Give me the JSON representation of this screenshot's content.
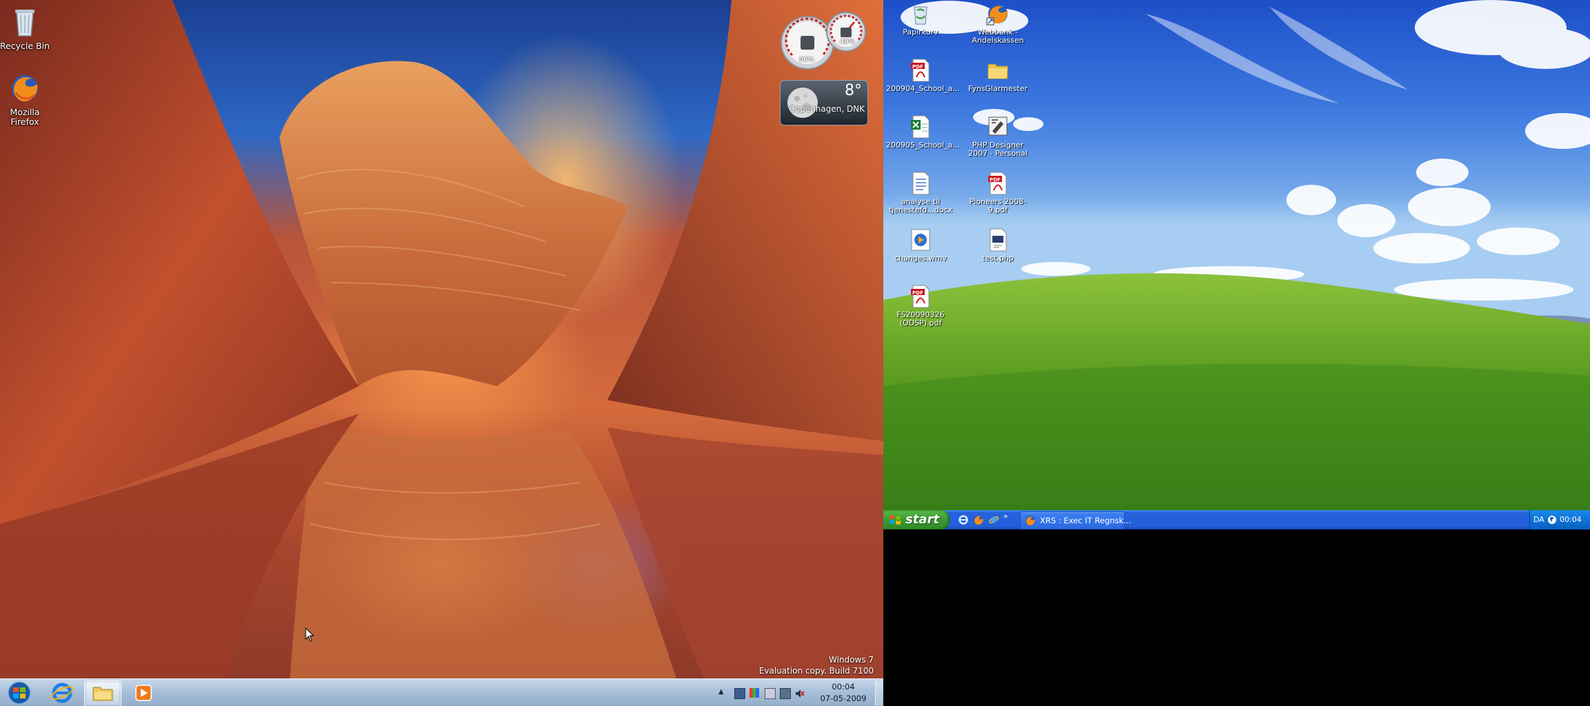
{
  "win7": {
    "desktop_icons": [
      {
        "label": "Recycle Bin",
        "icon": "recycle-bin-icon"
      },
      {
        "label": "Mozilla Firefox",
        "icon": "firefox-icon"
      }
    ],
    "cpu_meter": {
      "cpu": "06%",
      "memory": "49%"
    },
    "weather": {
      "temperature": "8°",
      "location": "Copenhagen, DNK"
    },
    "watermark": {
      "line1": "Windows 7",
      "line2": "Evaluation copy. Build 7100"
    },
    "taskbar": {
      "buttons": [
        {
          "icon": "start-orb-icon"
        },
        {
          "icon": "internet-explorer-icon"
        },
        {
          "icon": "windows-explorer-icon"
        },
        {
          "icon": "media-player-icon"
        }
      ],
      "tray_icons": [
        "show-hidden-icons",
        "network-icon",
        "color-tray-icon",
        "action-center-icon",
        "monitor-icon",
        "volume-muted-icon"
      ]
    },
    "clock": {
      "time": "00:04",
      "date": "07-05-2009"
    }
  },
  "winxp": {
    "desktop_icons": [
      {
        "label": "Papirkurv",
        "icon": "recycle-bin-icon"
      },
      {
        "label": "Webbank - Andelskassen",
        "icon": "firefox-shortcut-icon"
      },
      {
        "label": "200904_School_a...",
        "icon": "pdf-file-icon"
      },
      {
        "label": "FynsGlarmester",
        "icon": "folder-icon"
      },
      {
        "label": "200905_School_a...",
        "icon": "excel-file-icon"
      },
      {
        "label": "PHP Designer 2007 - Personal",
        "icon": "php-designer-icon"
      },
      {
        "label": "analyse til tjenestefd...docx",
        "icon": "word-file-icon"
      },
      {
        "label": "Pioneers 2008-9.pdf",
        "icon": "pdf-file-icon"
      },
      {
        "label": "changes.wmv",
        "icon": "video-file-icon"
      },
      {
        "label": "test.php",
        "icon": "php-file-icon"
      },
      {
        "label": "FS20090326 (ODSP).pdf",
        "icon": "pdf-file-icon"
      }
    ],
    "taskbar": {
      "start_label": "start",
      "quick_launch": [
        "internet-explorer-icon",
        "firefox-icon",
        "ie-alt-icon",
        "more-chevron-icon"
      ],
      "task_label": "XRS : Exec IT Regnsk...",
      "language": "DA",
      "clock": "00:04"
    }
  }
}
